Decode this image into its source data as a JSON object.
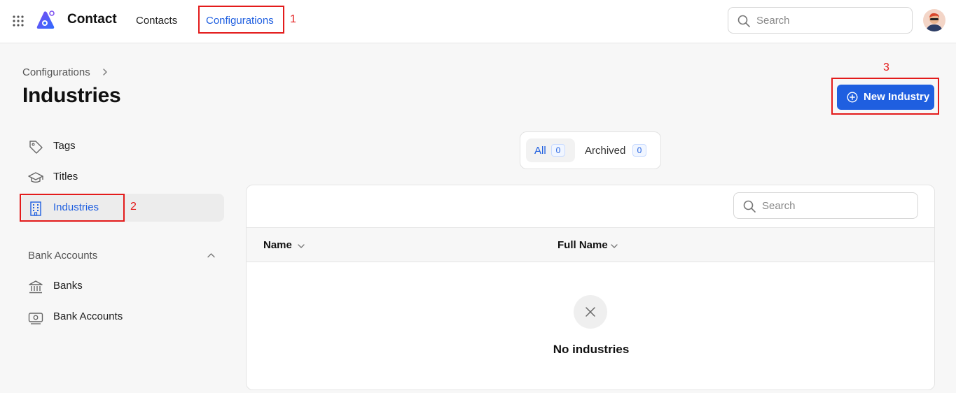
{
  "topbar": {
    "app_title": "Contact",
    "nav": [
      {
        "label": "Contacts"
      },
      {
        "label": "Configurations"
      }
    ],
    "search_placeholder": "Search"
  },
  "annotations": [
    "1",
    "2",
    "3"
  ],
  "page": {
    "breadcrumb": "Configurations",
    "title": "Industries",
    "new_button_label": "New Industry"
  },
  "sidebar": {
    "items": [
      {
        "label": "Tags",
        "icon": "tag-icon"
      },
      {
        "label": "Titles",
        "icon": "graduation-cap-icon"
      },
      {
        "label": "Industries",
        "icon": "building-icon",
        "active": true
      }
    ],
    "section_title": "Bank Accounts",
    "section_items": [
      {
        "label": "Banks",
        "icon": "bank-icon"
      },
      {
        "label": "Bank Accounts",
        "icon": "banknote-icon"
      }
    ]
  },
  "tabs": [
    {
      "label": "All",
      "count": "0",
      "active": true
    },
    {
      "label": "Archived",
      "count": "0"
    }
  ],
  "table": {
    "search_placeholder": "Search",
    "columns": [
      "Name",
      "Full Name"
    ],
    "empty_text": "No industries"
  },
  "colors": {
    "accent": "#1f5fe0",
    "highlight": "#e31b1b"
  }
}
